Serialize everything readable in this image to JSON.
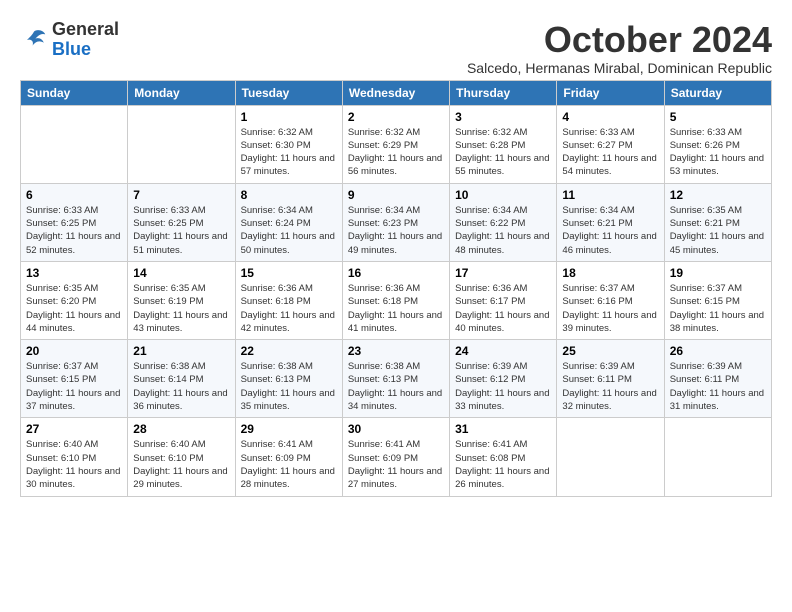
{
  "logo": {
    "general": "General",
    "blue": "Blue"
  },
  "title": "October 2024",
  "subtitle": "Salcedo, Hermanas Mirabal, Dominican Republic",
  "days_header": [
    "Sunday",
    "Monday",
    "Tuesday",
    "Wednesday",
    "Thursday",
    "Friday",
    "Saturday"
  ],
  "weeks": [
    [
      {
        "day": "",
        "info": ""
      },
      {
        "day": "",
        "info": ""
      },
      {
        "day": "1",
        "info": "Sunrise: 6:32 AM\nSunset: 6:30 PM\nDaylight: 11 hours and 57 minutes."
      },
      {
        "day": "2",
        "info": "Sunrise: 6:32 AM\nSunset: 6:29 PM\nDaylight: 11 hours and 56 minutes."
      },
      {
        "day": "3",
        "info": "Sunrise: 6:32 AM\nSunset: 6:28 PM\nDaylight: 11 hours and 55 minutes."
      },
      {
        "day": "4",
        "info": "Sunrise: 6:33 AM\nSunset: 6:27 PM\nDaylight: 11 hours and 54 minutes."
      },
      {
        "day": "5",
        "info": "Sunrise: 6:33 AM\nSunset: 6:26 PM\nDaylight: 11 hours and 53 minutes."
      }
    ],
    [
      {
        "day": "6",
        "info": "Sunrise: 6:33 AM\nSunset: 6:25 PM\nDaylight: 11 hours and 52 minutes."
      },
      {
        "day": "7",
        "info": "Sunrise: 6:33 AM\nSunset: 6:25 PM\nDaylight: 11 hours and 51 minutes."
      },
      {
        "day": "8",
        "info": "Sunrise: 6:34 AM\nSunset: 6:24 PM\nDaylight: 11 hours and 50 minutes."
      },
      {
        "day": "9",
        "info": "Sunrise: 6:34 AM\nSunset: 6:23 PM\nDaylight: 11 hours and 49 minutes."
      },
      {
        "day": "10",
        "info": "Sunrise: 6:34 AM\nSunset: 6:22 PM\nDaylight: 11 hours and 48 minutes."
      },
      {
        "day": "11",
        "info": "Sunrise: 6:34 AM\nSunset: 6:21 PM\nDaylight: 11 hours and 46 minutes."
      },
      {
        "day": "12",
        "info": "Sunrise: 6:35 AM\nSunset: 6:21 PM\nDaylight: 11 hours and 45 minutes."
      }
    ],
    [
      {
        "day": "13",
        "info": "Sunrise: 6:35 AM\nSunset: 6:20 PM\nDaylight: 11 hours and 44 minutes."
      },
      {
        "day": "14",
        "info": "Sunrise: 6:35 AM\nSunset: 6:19 PM\nDaylight: 11 hours and 43 minutes."
      },
      {
        "day": "15",
        "info": "Sunrise: 6:36 AM\nSunset: 6:18 PM\nDaylight: 11 hours and 42 minutes."
      },
      {
        "day": "16",
        "info": "Sunrise: 6:36 AM\nSunset: 6:18 PM\nDaylight: 11 hours and 41 minutes."
      },
      {
        "day": "17",
        "info": "Sunrise: 6:36 AM\nSunset: 6:17 PM\nDaylight: 11 hours and 40 minutes."
      },
      {
        "day": "18",
        "info": "Sunrise: 6:37 AM\nSunset: 6:16 PM\nDaylight: 11 hours and 39 minutes."
      },
      {
        "day": "19",
        "info": "Sunrise: 6:37 AM\nSunset: 6:15 PM\nDaylight: 11 hours and 38 minutes."
      }
    ],
    [
      {
        "day": "20",
        "info": "Sunrise: 6:37 AM\nSunset: 6:15 PM\nDaylight: 11 hours and 37 minutes."
      },
      {
        "day": "21",
        "info": "Sunrise: 6:38 AM\nSunset: 6:14 PM\nDaylight: 11 hours and 36 minutes."
      },
      {
        "day": "22",
        "info": "Sunrise: 6:38 AM\nSunset: 6:13 PM\nDaylight: 11 hours and 35 minutes."
      },
      {
        "day": "23",
        "info": "Sunrise: 6:38 AM\nSunset: 6:13 PM\nDaylight: 11 hours and 34 minutes."
      },
      {
        "day": "24",
        "info": "Sunrise: 6:39 AM\nSunset: 6:12 PM\nDaylight: 11 hours and 33 minutes."
      },
      {
        "day": "25",
        "info": "Sunrise: 6:39 AM\nSunset: 6:11 PM\nDaylight: 11 hours and 32 minutes."
      },
      {
        "day": "26",
        "info": "Sunrise: 6:39 AM\nSunset: 6:11 PM\nDaylight: 11 hours and 31 minutes."
      }
    ],
    [
      {
        "day": "27",
        "info": "Sunrise: 6:40 AM\nSunset: 6:10 PM\nDaylight: 11 hours and 30 minutes."
      },
      {
        "day": "28",
        "info": "Sunrise: 6:40 AM\nSunset: 6:10 PM\nDaylight: 11 hours and 29 minutes."
      },
      {
        "day": "29",
        "info": "Sunrise: 6:41 AM\nSunset: 6:09 PM\nDaylight: 11 hours and 28 minutes."
      },
      {
        "day": "30",
        "info": "Sunrise: 6:41 AM\nSunset: 6:09 PM\nDaylight: 11 hours and 27 minutes."
      },
      {
        "day": "31",
        "info": "Sunrise: 6:41 AM\nSunset: 6:08 PM\nDaylight: 11 hours and 26 minutes."
      },
      {
        "day": "",
        "info": ""
      },
      {
        "day": "",
        "info": ""
      }
    ]
  ]
}
